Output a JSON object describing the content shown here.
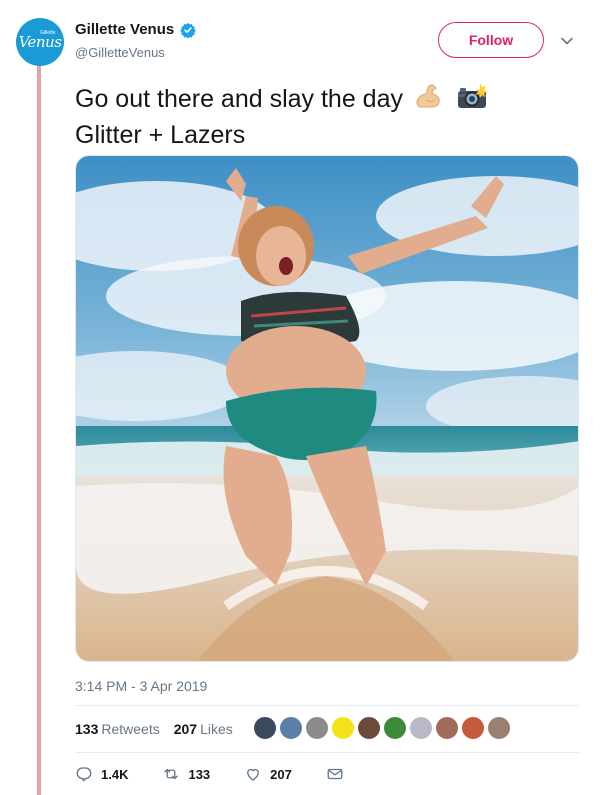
{
  "account": {
    "display_name": "Gillette Venus",
    "handle": "@GilletteVenus",
    "avatar_text": "Venus",
    "avatar_small_text": "Gillette",
    "verified": true,
    "accent_color": "#1a9ad6"
  },
  "follow_button": {
    "label": "Follow",
    "color": "#e0245e"
  },
  "tweet": {
    "line1": "Go out there and slay the day",
    "line1_emojis": [
      "flexed-biceps-icon",
      "camera-flash-icon"
    ],
    "line2": "Glitter + Lazers"
  },
  "media": {
    "icon": "photo-beach-woman-bikini"
  },
  "timestamp": "3:14 PM - 3 Apr 2019",
  "stats": {
    "retweets_count": "133",
    "retweets_label": "Retweets",
    "likes_count": "207",
    "likes_label": "Likes"
  },
  "likers": [
    "#3b4a5a",
    "#5b7fa6",
    "#8c8c8c",
    "#f5e21a",
    "#6b4a3a",
    "#3d8a3a",
    "#b8b8c8",
    "#a36b5a",
    "#c45a3a",
    "#9a8070"
  ],
  "actions": {
    "reply_count": "1.4K",
    "retweet_count": "133",
    "like_count": "207"
  }
}
